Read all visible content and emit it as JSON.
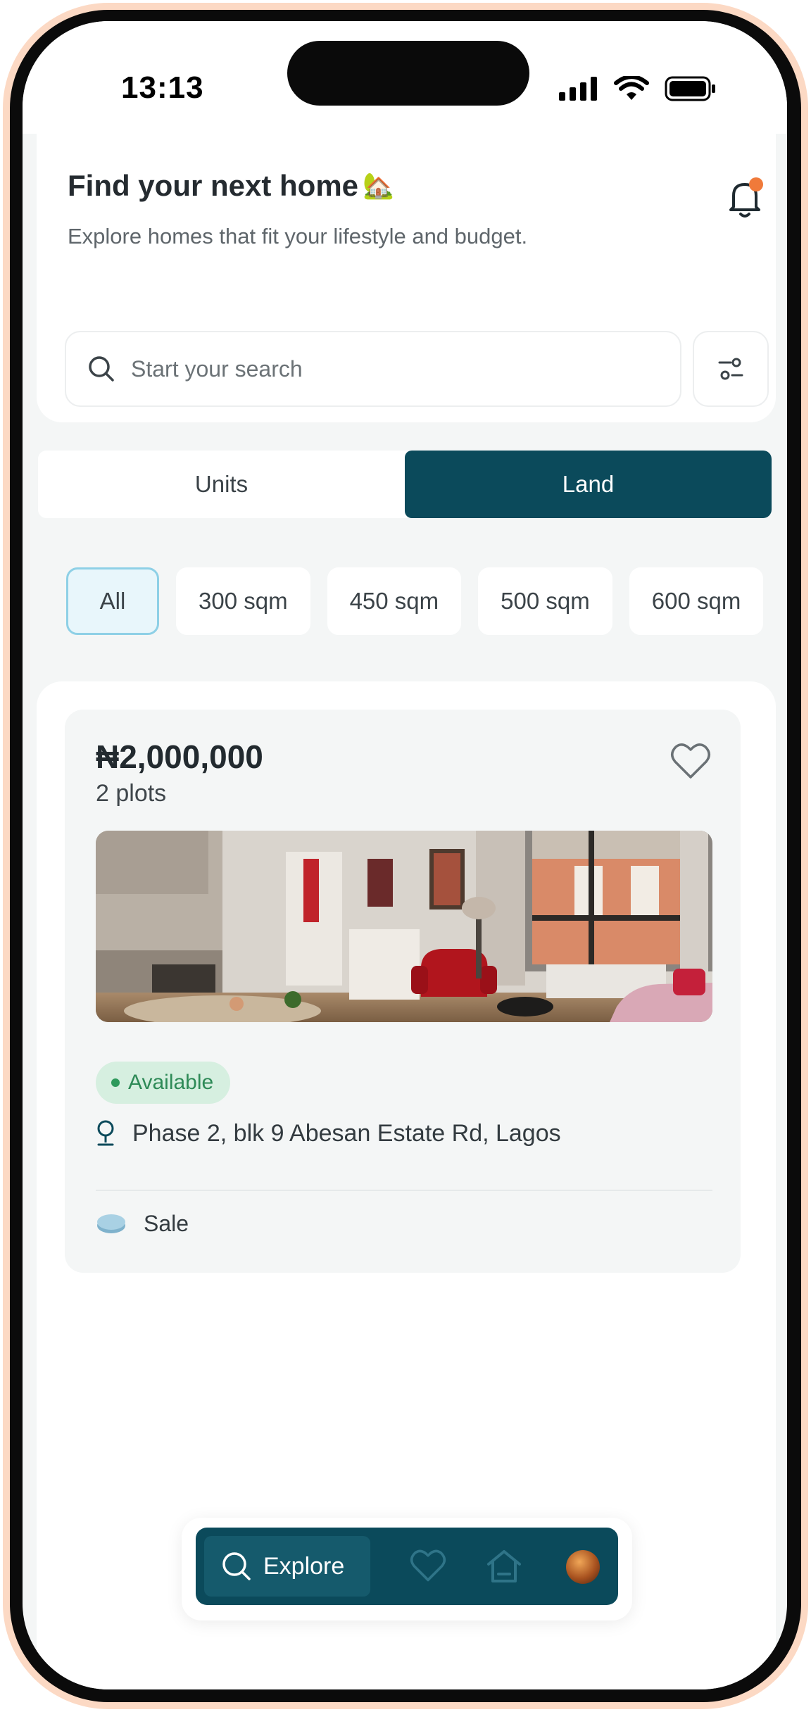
{
  "status_bar": {
    "time": "13:13"
  },
  "header": {
    "title": "Find your next home",
    "title_emoji": "🏡",
    "subtitle": "Explore homes that fit your lifestyle and budget."
  },
  "search": {
    "placeholder": "Start your search"
  },
  "segment": {
    "tabs": [
      {
        "label": "Units",
        "active": false
      },
      {
        "label": "Land",
        "active": true
      }
    ]
  },
  "chips": [
    {
      "label": "All",
      "active": true
    },
    {
      "label": "300 sqm"
    },
    {
      "label": "450 sqm"
    },
    {
      "label": "500 sqm"
    },
    {
      "label": "600 sqm"
    }
  ],
  "listing": {
    "price": "₦2,000,000",
    "plots": "2 plots",
    "status": "Available",
    "address": "Phase 2, blk 9 Abesan Estate Rd, Lagos",
    "type": "Sale"
  },
  "nav": {
    "explore_label": "Explore"
  },
  "colors": {
    "brand": "#0b4a5b",
    "accent_dot": "#f07a3a",
    "available": "#2e8a57",
    "chip_active_border": "#8ed0e6"
  }
}
